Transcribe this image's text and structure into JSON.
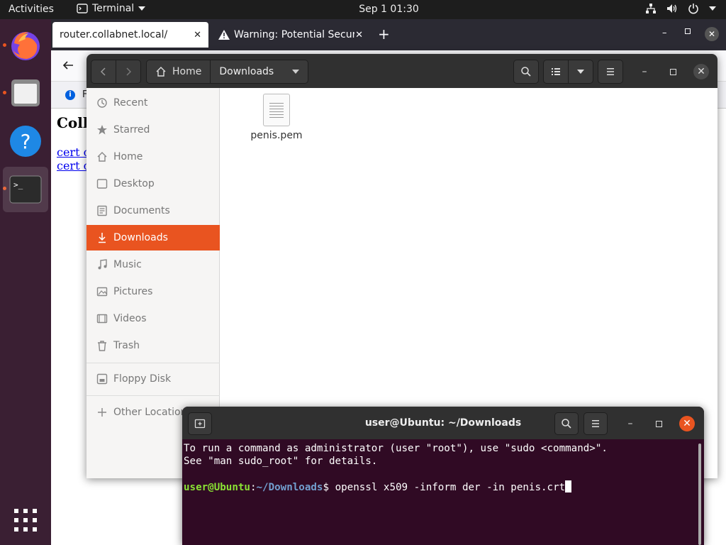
{
  "topbar": {
    "activities": "Activities",
    "app_name": "Terminal",
    "clock": "Sep 1  01:30"
  },
  "dock": {
    "items": [
      {
        "icon": "firefox-icon"
      },
      {
        "icon": "files-icon"
      },
      {
        "icon": "help-icon"
      },
      {
        "icon": "terminal-icon"
      }
    ]
  },
  "firefox": {
    "tabs": [
      {
        "label": "router.collabnet.local/"
      },
      {
        "label": "Warning: Potential Securi"
      }
    ],
    "info_icon_letter": "F",
    "page": {
      "heading": "Coll",
      "links": [
        "cert c",
        "cert c"
      ]
    }
  },
  "files": {
    "path": {
      "home": "Home",
      "current": "Downloads"
    },
    "sidebar": [
      {
        "label": "Recent",
        "icon": "clock-icon"
      },
      {
        "label": "Starred",
        "icon": "star-icon"
      },
      {
        "label": "Home",
        "icon": "home-icon"
      },
      {
        "label": "Desktop",
        "icon": "desktop-icon"
      },
      {
        "label": "Documents",
        "icon": "documents-icon"
      },
      {
        "label": "Downloads",
        "icon": "download-icon"
      },
      {
        "label": "Music",
        "icon": "music-icon"
      },
      {
        "label": "Pictures",
        "icon": "pictures-icon"
      },
      {
        "label": "Videos",
        "icon": "videos-icon"
      },
      {
        "label": "Trash",
        "icon": "trash-icon"
      },
      {
        "label": "Floppy Disk",
        "icon": "floppy-icon"
      },
      {
        "label": "Other Locations",
        "icon": "plus-icon"
      }
    ],
    "files": [
      {
        "name": "penis.pem"
      }
    ]
  },
  "terminal": {
    "title": "user@Ubuntu: ~/Downloads",
    "line1": "To run a command as administrator (user \"root\"), use \"sudo <command>\".",
    "line2": "See \"man sudo_root\" for details.",
    "prompt_user": "user@Ubuntu",
    "prompt_colon": ":",
    "prompt_path": "~/Downloads",
    "prompt_dollar": "$ ",
    "command": "openssl x509 -inform der -in penis.crt"
  },
  "colors": {
    "accent": "#e95420",
    "terminal_bg": "#300a24",
    "prompt_user": "#8ae234",
    "prompt_path": "#729fcf"
  }
}
